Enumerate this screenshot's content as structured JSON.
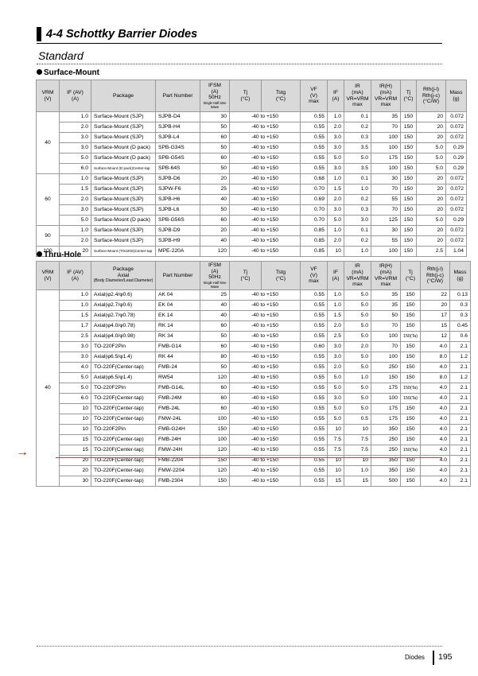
{
  "header": {
    "title": "4-4 Schottky Barrier Diodes",
    "subtitle": "Standard"
  },
  "surface": {
    "title": "Surface-Mount",
    "headers": {
      "vrm": [
        "VRM",
        "(V)"
      ],
      "if": [
        "IF (AV)",
        "(A)"
      ],
      "package": "Package",
      "part": "Part Number",
      "ifsm": [
        "IFSM",
        "(A)",
        "50Hz",
        "Single Half Sine Wave"
      ],
      "tj": [
        "Tj",
        "(°C)"
      ],
      "tstg": [
        "Tstg",
        "(°C)"
      ],
      "vf": [
        "VF",
        "(V)",
        "max"
      ],
      "vfif": [
        "IF",
        "(A)"
      ],
      "ir": [
        "IR",
        "(mA)",
        "VR=VRM",
        "max"
      ],
      "irh": [
        "IR(H)",
        "(mA)",
        "VR=VRM",
        "max"
      ],
      "tj2": [
        "Tj",
        "(°C)"
      ],
      "rth": [
        "Rth(j-l)",
        "Rth(j-c)",
        "(°C/W)"
      ],
      "mass": [
        "Mass",
        "(g)"
      ]
    },
    "groups": [
      {
        "vrm": "40",
        "rows": [
          [
            "1.0",
            "Surface-Mount (SJP)",
            "SJPB-D4",
            "30",
            "-40 to +150",
            "0.55",
            "1.0",
            "0.1",
            "35",
            "150",
            "20",
            "0.072"
          ],
          [
            "2.0",
            "Surface-Mount (SJP)",
            "SJPB-H4",
            "50",
            "-40 to +150",
            "0.55",
            "2.0",
            "0.2",
            "70",
            "150",
            "20",
            "0.072"
          ],
          [
            "3.0",
            "Surface-Mount (SJP)",
            "SJPB-L4",
            "60",
            "-40 to +150",
            "0.55",
            "3.0",
            "0.3",
            "100",
            "150",
            "20",
            "0.072"
          ],
          [
            "3.0",
            "Surface-Mount (D pack)",
            "SPB-G34S",
            "50",
            "-40 to +150",
            "0.55",
            "3.0",
            "3.5",
            "100",
            "150",
            "5.0",
            "0.29"
          ],
          [
            "5.0",
            "Surface-Mount (D pack)",
            "SPB-G54S",
            "60",
            "-40 to +150",
            "0.55",
            "5.0",
            "5.0",
            "175",
            "150",
            "5.0",
            "0.29"
          ],
          [
            "6.0",
            "Surface-Mount (D pack)Center-tap",
            "SPB-64S",
            "50",
            "-40 to +150",
            "0.55",
            "3.0",
            "3.5",
            "100",
            "150",
            "5.0",
            "0.29"
          ]
        ]
      },
      {
        "vrm": "60",
        "rows": [
          [
            "1.0",
            "Surface-Mount (SJP)",
            "SJPB-D6",
            "20",
            "-40 to +150",
            "0.68",
            "1.0",
            "0.1",
            "30",
            "150",
            "20",
            "0.072"
          ],
          [
            "1.5",
            "Surface-Mount (SJP)",
            "SJPW-F6",
            "25",
            "-40 to +150",
            "0.70",
            "1.5",
            "1.0",
            "70",
            "150",
            "20",
            "0.072"
          ],
          [
            "2.0",
            "Surface-Mount (SJP)",
            "SJPB-H6",
            "40",
            "-40 to +150",
            "0.69",
            "2.0",
            "0.2",
            "55",
            "150",
            "20",
            "0.072"
          ],
          [
            "3.0",
            "Surface-Mount (SJP)",
            "SJPB-L6",
            "50",
            "-40 to +150",
            "0.70",
            "3.0",
            "0.3",
            "70",
            "150",
            "20",
            "0.072"
          ],
          [
            "5.0",
            "Surface-Mount (D pack)",
            "SPB-G56S",
            "60",
            "-40 to +150",
            "0.70",
            "5.0",
            "3.0",
            "125",
            "150",
            "5.0",
            "0.29"
          ]
        ]
      },
      {
        "vrm": "90",
        "rows": [
          [
            "1.0",
            "Surface-Mount (SJP)",
            "SJPB-D9",
            "20",
            "-40 to +150",
            "0.85",
            "1.0",
            "0.1",
            "30",
            "150",
            "20",
            "0.072"
          ],
          [
            "2.0",
            "Surface-Mount (SJP)",
            "SJPB-H9",
            "40",
            "-40 to +150",
            "0.85",
            "2.0",
            "0.2",
            "55",
            "150",
            "20",
            "0.072"
          ]
        ]
      },
      {
        "vrm": "100",
        "rows": [
          [
            "20",
            "Surface-Mount (TO220S)Center-tap",
            "MPE-220A",
            "120",
            "-40 to +150",
            "0.85",
            "10",
            "1.0",
            "100",
            "150",
            "2.5",
            "1.04"
          ]
        ]
      }
    ]
  },
  "thru": {
    "title": "Thru-Hole",
    "headers": {
      "vrm": [
        "VRM",
        "(V)"
      ],
      "if": [
        "IF (AV)",
        "(A)"
      ],
      "package": [
        "Package",
        "Axial",
        "(Body Diameter/Lead Diameter)"
      ],
      "part": "Part Number",
      "ifsm": [
        "IFSM",
        "(A)",
        "50Hz",
        "Single Half Sine Wave"
      ],
      "tj": [
        "Tj",
        "(°C)"
      ],
      "tstg": [
        "Tstg",
        "(°C)"
      ],
      "vf": [
        "VF",
        "(V)",
        "max"
      ],
      "vfif": [
        "IF",
        "(A)"
      ],
      "ir": [
        "IR",
        "(mA)",
        "VR=VRM",
        "max"
      ],
      "irh": [
        "IR(H)",
        "(mA)",
        "VR=VRM",
        "max"
      ],
      "tj2": [
        "Tj",
        "(°C)"
      ],
      "rth": [
        "Rth(j-l)",
        "Rth(j-c)",
        "(°C/W)"
      ],
      "mass": [
        "Mass",
        "(g)"
      ]
    },
    "groups": [
      {
        "vrm": "40",
        "rows": [
          [
            "1.0",
            "Axial(φ2.4/φ0.6)",
            "AK 04",
            "25",
            "-40 to +150",
            "0.55",
            "1.0",
            "5.0",
            "35",
            "150",
            "22",
            "0.13"
          ],
          [
            "1.0",
            "Axial(φ2.7/φ0.6)",
            "EK 04",
            "40",
            "-40 to +150",
            "0.55",
            "1.0",
            "5.0",
            "35",
            "150",
            "20",
            "0.3"
          ],
          [
            "1.5",
            "Axial(φ2.7/φ0.78)",
            "EK 14",
            "40",
            "-40 to +150",
            "0.55",
            "1.5",
            "5.0",
            "50",
            "150",
            "17",
            "0.3"
          ],
          [
            "1.7",
            "Axial(φ4.0/φ0.78)",
            "RK 14",
            "60",
            "-40 to +150",
            "0.55",
            "2.0",
            "5.0",
            "70",
            "150",
            "15",
            "0.45"
          ],
          [
            "2.5",
            "Axial(φ4.0/φ0.98)",
            "RK 34",
            "50",
            "-40 to +150",
            "0.55",
            "2.5",
            "5.0",
            "100",
            "150(Ta)",
            "12",
            "0.6"
          ],
          [
            "3.0",
            "TO-220F2Pin",
            "FMB-G14",
            "60",
            "-40 to +150",
            "0.60",
            "3.0",
            "2.0",
            "70",
            "150",
            "4.0",
            "2.1"
          ],
          [
            "3.0",
            "Axial(φ6.5/φ1.4)",
            "RK 44",
            "80",
            "-40 to +150",
            "0.55",
            "3.0",
            "5.0",
            "100",
            "150",
            "8.0",
            "1.2"
          ],
          [
            "4.0",
            "TO-220F(Center-tap)",
            "FMB-24",
            "50",
            "-40 to +150",
            "0.55",
            "2.0",
            "5.0",
            "250",
            "150",
            "4.0",
            "2.1"
          ],
          [
            "5.0",
            "Axial(φ6.5/φ1.4)",
            "RW54",
            "120",
            "-40 to +150",
            "0.55",
            "5.0",
            "1.0",
            "150",
            "150",
            "8.0",
            "1.2"
          ],
          [
            "5.0",
            "TO-220F2Pin",
            "FMB-G14L",
            "60",
            "-40 to +150",
            "0.55",
            "5.0",
            "5.0",
            "175",
            "150(Ta)",
            "4.0",
            "2.1"
          ],
          [
            "6.0",
            "TO-220F(Center-tap)",
            "FMB-24M",
            "60",
            "-40 to +150",
            "0.55",
            "3.0",
            "5.0",
            "100",
            "150(Ta)",
            "4.0",
            "2.1"
          ],
          [
            "10",
            "TO-220F(Center-tap)",
            "FMB-24L",
            "60",
            "-40 to +150",
            "0.55",
            "5.0",
            "5.0",
            "175",
            "150",
            "4.0",
            "2.1"
          ],
          [
            "10",
            "TO-220F(Center-tap)",
            "FMW-24L",
            "100",
            "-40 to +150",
            "0.55",
            "5.0",
            "0.5",
            "175",
            "150",
            "4.0",
            "2.1"
          ],
          [
            "10",
            "TO-220F2Pin",
            "FMB-G24H",
            "150",
            "-40 to +150",
            "0.55",
            "10",
            "10",
            "350",
            "150",
            "4.0",
            "2.1"
          ],
          [
            "15",
            "TO-220F(Center-tap)",
            "FMB-24H",
            "100",
            "-40 to +150",
            "0.55",
            "7.5",
            "7.5",
            "250",
            "150",
            "4.0",
            "2.1"
          ],
          [
            "15",
            "TO-220F(Center-tap)",
            "FMW-24H",
            "120",
            "-40 to +150",
            "0.55",
            "7.5",
            "7.5",
            "250",
            "150(Ta)",
            "4.0",
            "2.1"
          ],
          [
            "20",
            "TO-220F(Center-tap)",
            "FMB-2204",
            "150",
            "-40 to +150",
            "0.55",
            "10",
            "10",
            "350",
            "150",
            "4.0",
            "2.1"
          ],
          [
            "20",
            "TO-220F(Center-tap)",
            "FMW-2204",
            "120",
            "-40 to +150",
            "0.55",
            "10",
            "1.0",
            "350",
            "150",
            "4.0",
            "2.1"
          ],
          [
            "30",
            "TO-220F(Center-tap)",
            "FMB-2304",
            "150",
            "-40 to +150",
            "0.55",
            "15",
            "15",
            "500",
            "150",
            "4.0",
            "2.1"
          ]
        ]
      }
    ]
  },
  "annotation": {
    "arrow_glyph": "→",
    "arrow_color": "#d11111",
    "line_color": "#e03030"
  },
  "footer": {
    "label": "Diodes",
    "page": "195"
  }
}
